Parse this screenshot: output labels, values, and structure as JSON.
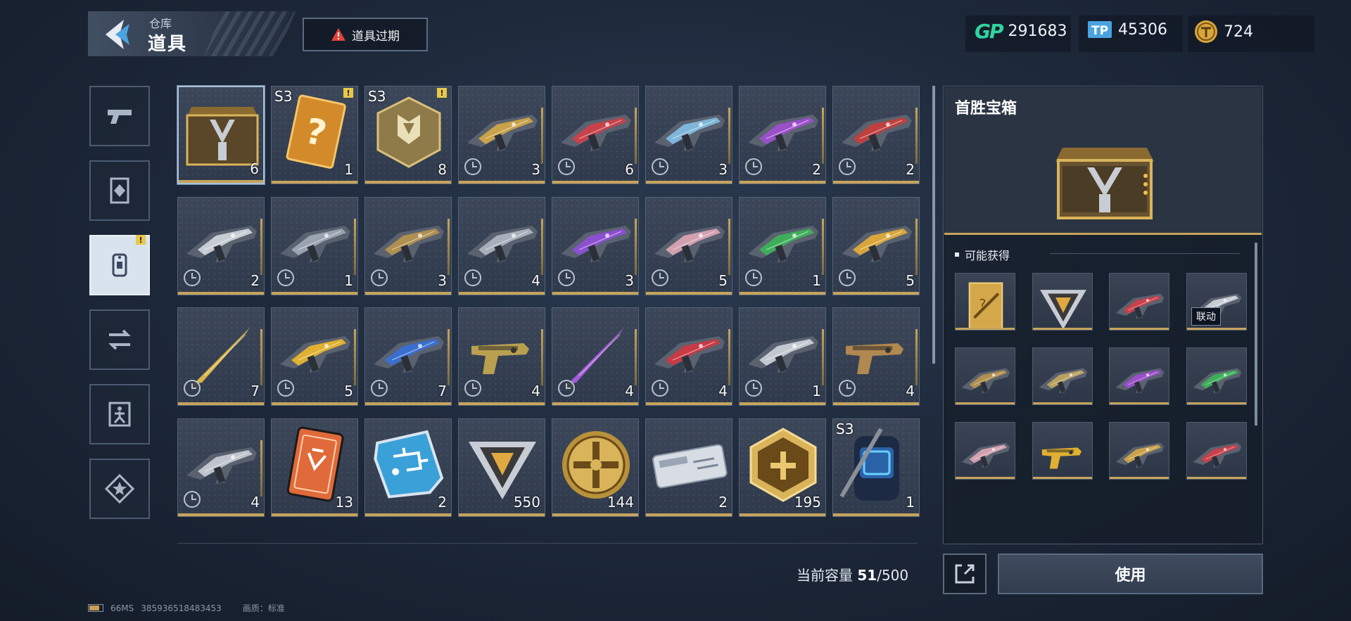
{
  "header": {
    "breadcrumb_parent": "仓库",
    "title": "道具",
    "expired_button_label": "道具过期"
  },
  "currencies": [
    {
      "icon": "gp-icon",
      "value": "291683"
    },
    {
      "icon": "tp-icon",
      "value": "45306"
    },
    {
      "icon": "gold-coin-icon",
      "value": "724"
    }
  ],
  "sidebar": {
    "tabs": [
      {
        "name": "weapons",
        "icon": "pistol-icon",
        "active": false
      },
      {
        "name": "cards",
        "icon": "card-frame-icon",
        "active": false
      },
      {
        "name": "items",
        "icon": "dog-tag-icon",
        "active": true,
        "alert": "!"
      },
      {
        "name": "exchange",
        "icon": "swap-icon",
        "active": false
      },
      {
        "name": "character",
        "icon": "figure-icon",
        "active": false
      },
      {
        "name": "favorites",
        "icon": "star-icon",
        "active": false
      }
    ]
  },
  "grid": {
    "items": [
      {
        "type": "chest",
        "count": "6",
        "selected": true
      },
      {
        "type": "mystery-card",
        "count": "1",
        "season": "S3",
        "alert": "!"
      },
      {
        "type": "crate",
        "count": "8",
        "season": "S3",
        "alert": "!"
      },
      {
        "type": "rifle",
        "count": "3",
        "timed": true,
        "color": "#c9a24a"
      },
      {
        "type": "rifle",
        "count": "6",
        "timed": true,
        "color": "#c8414b"
      },
      {
        "type": "rifle",
        "count": "3",
        "timed": true,
        "color": "#7fb6d9"
      },
      {
        "type": "rifle",
        "count": "2",
        "timed": true,
        "color": "#9b4fc9"
      },
      {
        "type": "rifle",
        "count": "2",
        "timed": true,
        "color": "#c04040"
      },
      {
        "type": "smg",
        "count": "2",
        "timed": true,
        "color": "#c8ccd4"
      },
      {
        "type": "rifle",
        "count": "1",
        "timed": true,
        "color": "#9aa3b0"
      },
      {
        "type": "rifle",
        "count": "3",
        "timed": true,
        "color": "#b09050"
      },
      {
        "type": "rifle",
        "count": "4",
        "timed": true,
        "color": "#a9b0bb"
      },
      {
        "type": "rifle",
        "count": "3",
        "timed": true,
        "color": "#8c4fd0"
      },
      {
        "type": "rifle",
        "count": "5",
        "timed": true,
        "color": "#d3a0b0"
      },
      {
        "type": "rifle",
        "count": "1",
        "timed": true,
        "color": "#3fae5a"
      },
      {
        "type": "rifle",
        "count": "5",
        "timed": true,
        "color": "#d9a63c"
      },
      {
        "type": "knife",
        "count": "7",
        "timed": true,
        "color": "#d9b44a"
      },
      {
        "type": "rifle",
        "count": "5",
        "timed": true,
        "color": "#e0b030"
      },
      {
        "type": "rifle",
        "count": "7",
        "timed": true,
        "color": "#3a6fd0"
      },
      {
        "type": "pistol",
        "count": "4",
        "timed": true,
        "color": "#b9a050"
      },
      {
        "type": "knife",
        "count": "4",
        "timed": true,
        "color": "#a65bd6"
      },
      {
        "type": "rifle",
        "count": "4",
        "timed": true,
        "color": "#c83a44"
      },
      {
        "type": "rifle",
        "count": "1",
        "timed": true,
        "color": "#c4c8d0"
      },
      {
        "type": "pistol",
        "count": "4",
        "timed": true,
        "color": "#b08850"
      },
      {
        "type": "rifle",
        "count": "4",
        "timed": true,
        "color": "#c0c4cc"
      },
      {
        "type": "orange-card",
        "count": "13"
      },
      {
        "type": "blue-chip",
        "count": "2"
      },
      {
        "type": "triangle-token",
        "count": "550"
      },
      {
        "type": "gold-coin",
        "count": "144"
      },
      {
        "type": "metal-case",
        "count": "2"
      },
      {
        "type": "hex-badge",
        "count": "195"
      },
      {
        "type": "backpack",
        "count": "1",
        "season": "S3"
      }
    ]
  },
  "capacity": {
    "label": "当前容量",
    "current": "51",
    "max": "/500"
  },
  "detail": {
    "title": "首胜宝箱",
    "possible_label": "可能获得",
    "rewards": [
      {
        "type": "gold-card",
        "color": "#d4a84a"
      },
      {
        "type": "triangle-token",
        "color": "#e0b050"
      },
      {
        "type": "rifle",
        "color": "#c8414b"
      },
      {
        "type": "rifle",
        "color": "#c8ccd4",
        "tag": "联动"
      },
      {
        "type": "rifle",
        "color": "#b09050"
      },
      {
        "type": "rifle",
        "color": "#b8a060"
      },
      {
        "type": "rifle",
        "color": "#9b4fc9"
      },
      {
        "type": "rifle",
        "color": "#3fae5a"
      },
      {
        "type": "rifle",
        "color": "#d3a0b0"
      },
      {
        "type": "pistol",
        "color": "#e0b030"
      },
      {
        "type": "rifle",
        "color": "#c9a24a"
      },
      {
        "type": "rifle",
        "color": "#c8414b"
      }
    ],
    "use_button_label": "使用"
  },
  "status": {
    "ping": "66MS",
    "uid": "385936518483453",
    "quality": "画质：标准"
  },
  "colors": {
    "accent_gold": "#c6a45c",
    "gp_green": "#30d4a0",
    "tp_blue": "#4aa3e0",
    "warning_red": "#e0443c"
  }
}
